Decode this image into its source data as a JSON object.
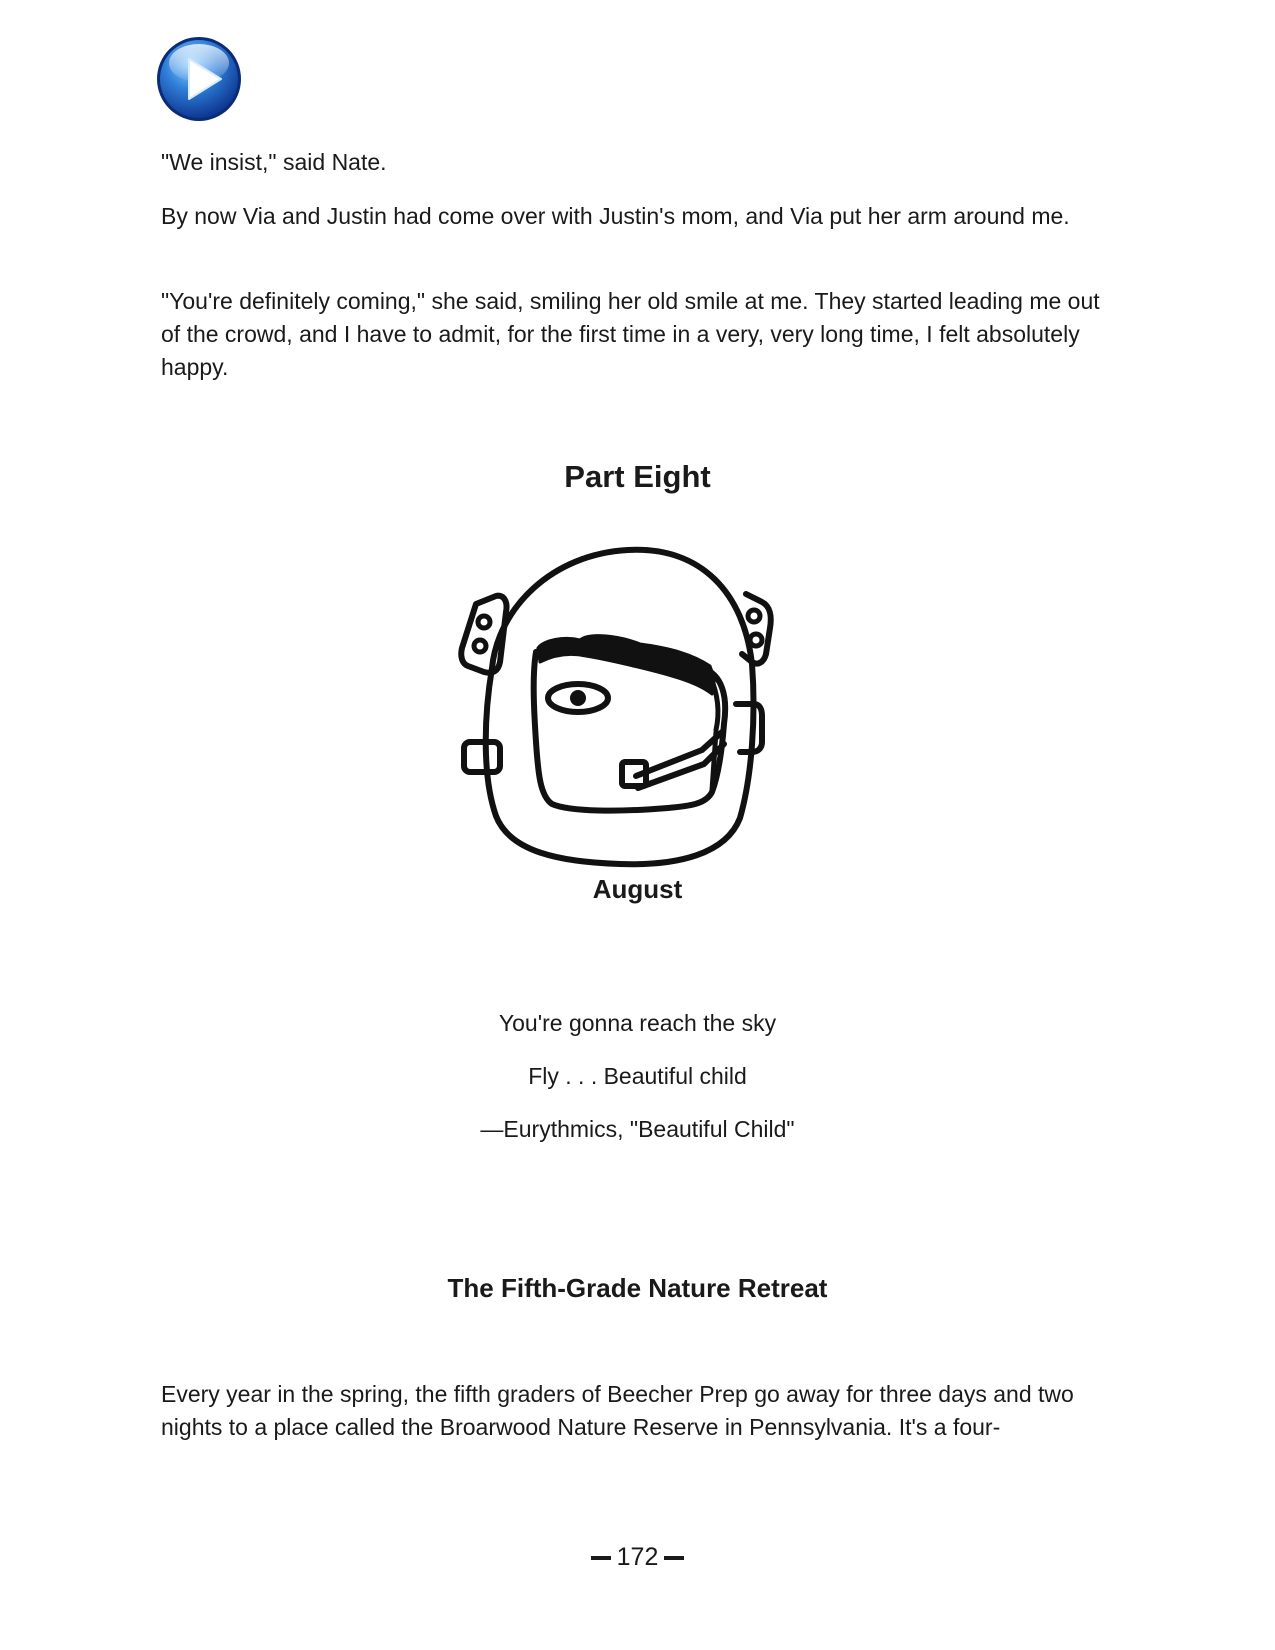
{
  "icons": {
    "play": "play-icon"
  },
  "colors": {
    "play_button_outer": "#0b3a9e",
    "play_button_inner": "#3f8fe0",
    "text": "#1a1a1a"
  },
  "paragraphs_top": [
    "\"We insist,\" said Nate.",
    "By now Via and Justin had come over with Justin's mom,  and Via put her arm around me.",
    "\"You're definitely coming,\" she said, smiling her old smile at  me. They started leading me out of the crowd, and I have to  admit, for the first time in a very, very long time, I felt absolutely happy."
  ],
  "part_heading": "Part Eight",
  "narrator": "August",
  "epigraph": {
    "line1": "You're gonna reach the sky",
    "line2": "Fly . . . Beautiful child",
    "attribution": "—Eurythmics, \"Beautiful Child\""
  },
  "chapter_heading": "The Fifth-Grade Nature Retreat",
  "paragraph_bottom": "Every year in the spring, the fifth graders of Beecher Prep  go away for three days and two nights to a place called the  Broarwood Nature Reserve in Pennsylvania. It's a four-",
  "page_number": "172"
}
